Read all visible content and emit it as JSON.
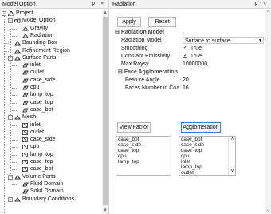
{
  "left_panel": {
    "title": "Model Option",
    "title_buttons": "p ×",
    "tree": [
      {
        "label": "Project",
        "depth": 0,
        "icon": "project-icon",
        "toggle": "-"
      },
      {
        "label": "Model Option",
        "depth": 1,
        "icon": "model-option-icon",
        "toggle": "-"
      },
      {
        "label": "Gravity",
        "depth": 2,
        "icon": "gravity-icon"
      },
      {
        "label": "Radiation",
        "depth": 2,
        "icon": "radiation-icon"
      },
      {
        "label": "Bounding Box",
        "depth": 1,
        "icon": "bounding-box-icon"
      },
      {
        "label": "Refinement Region",
        "depth": 1,
        "icon": "refinement-region-icon"
      },
      {
        "label": "Surface Parts",
        "depth": 1,
        "icon": "surface-parts-icon",
        "toggle": "-"
      },
      {
        "label": "inlet",
        "depth": 2,
        "icon": "surface-part-icon"
      },
      {
        "label": "outlet",
        "depth": 2,
        "icon": "surface-part-icon"
      },
      {
        "label": "case_side",
        "depth": 2,
        "icon": "surface-part-icon"
      },
      {
        "label": "cpu",
        "depth": 2,
        "icon": "surface-part-icon"
      },
      {
        "label": "lamp_top",
        "depth": 2,
        "icon": "surface-part-icon"
      },
      {
        "label": "case_top",
        "depth": 2,
        "icon": "surface-part-icon"
      },
      {
        "label": "case_bot",
        "depth": 2,
        "icon": "surface-part-icon"
      },
      {
        "label": "Mesh",
        "depth": 1,
        "icon": "mesh-icon",
        "toggle": "-"
      },
      {
        "label": "inlet",
        "depth": 2,
        "icon": "mesh-part-icon"
      },
      {
        "label": "outlet",
        "depth": 2,
        "icon": "mesh-part-icon"
      },
      {
        "label": "case_side",
        "depth": 2,
        "icon": "mesh-part-icon"
      },
      {
        "label": "cpu",
        "depth": 2,
        "icon": "mesh-part-icon"
      },
      {
        "label": "lamp_top",
        "depth": 2,
        "icon": "mesh-part-icon"
      },
      {
        "label": "case_top",
        "depth": 2,
        "icon": "mesh-part-icon"
      },
      {
        "label": "case_bot",
        "depth": 2,
        "icon": "mesh-part-icon"
      },
      {
        "label": "Volume Parts",
        "depth": 1,
        "icon": "volume-parts-icon",
        "toggle": "-"
      },
      {
        "label": "Fluid Domain",
        "depth": 2,
        "icon": "volume-part-icon"
      },
      {
        "label": "Solid Domain",
        "depth": 2,
        "icon": "volume-part-icon"
      },
      {
        "label": "Boundary Conditions",
        "depth": 1,
        "icon": "boundary-conditions-icon",
        "toggle": "-"
      }
    ]
  },
  "right_panel": {
    "title": "Radiation",
    "title_buttons": "p ×",
    "apply_label": "Apply",
    "reset_label": "Reset",
    "section_title": "Radiation Model",
    "properties": [
      {
        "name": "Radiation Model",
        "value": "Surface to surface",
        "kind": "dropdown"
      },
      {
        "name": "Smoothing",
        "value": "True",
        "kind": "checkbox",
        "checked": true
      },
      {
        "name": "Constant Emissivity",
        "value": "True",
        "kind": "checkbox",
        "checked": true
      },
      {
        "name": "Max Raysy",
        "value": "10000000",
        "kind": "text"
      }
    ],
    "subsection_title": "Face Agglomeration",
    "sub_properties": [
      {
        "name": "Feature Angle",
        "value": "20"
      },
      {
        "name": "Faces Number in Coa...",
        "value": "16"
      }
    ],
    "view_factor_label": "View Factor",
    "agglomeration_label": "Agglomeration",
    "view_factor_list": [
      "case_bot",
      "case_side",
      "case_top",
      "cpu",
      "lamp_top"
    ],
    "agglomeration_list": [
      "case_bot",
      "case_side",
      "case_top",
      "cpu",
      "inlet",
      "lamp_top",
      "outlet"
    ]
  },
  "colors": {
    "accent": "#3a7bd5",
    "section_header": "#4a4a4a",
    "icon_dark": "#333333"
  }
}
